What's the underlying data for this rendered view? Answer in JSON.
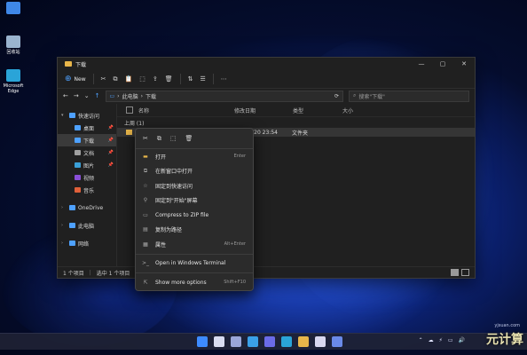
{
  "desktop": {
    "icons": [
      {
        "label": "",
        "icon": "monitor-icon",
        "color": "#3f87e8"
      },
      {
        "label": "回收站",
        "icon": "recycle-bin-icon",
        "color": "#9ab4cf"
      },
      {
        "label": "Microsoft Edge",
        "icon": "edge-icon",
        "color": "#2aa4d8"
      }
    ]
  },
  "window": {
    "title": "下载",
    "controls": [
      "—",
      "▢",
      "✕"
    ]
  },
  "toolbar": {
    "new_label": "New",
    "icons": [
      "cut-icon",
      "copy-icon",
      "paste-icon",
      "rename-icon",
      "share-icon",
      "delete-icon",
      "sort-icon",
      "view-icon",
      "more-icon"
    ],
    "glyphs": {
      "cut": "✂",
      "copy": "⧉",
      "paste": "📋",
      "rename": "⬚",
      "share": "⇪",
      "delete": "🗑",
      "sort": "⇅",
      "view": "☰",
      "more": "⋯"
    }
  },
  "address": {
    "path": [
      "此电脑",
      "下载"
    ],
    "search_placeholder": "搜索\"下载\""
  },
  "nav": {
    "items": [
      {
        "label": "快速访问",
        "icon": "star-icon",
        "color": "#4ea1ff",
        "chev": "▾",
        "level": 0,
        "pin": false,
        "selected": false
      },
      {
        "label": "桌面",
        "icon": "desktop-icon",
        "color": "#4ea1ff",
        "chev": "",
        "level": 1,
        "pin": true,
        "selected": false
      },
      {
        "label": "下载",
        "icon": "download-icon",
        "color": "#4ea1ff",
        "chev": "",
        "level": 1,
        "pin": true,
        "selected": true
      },
      {
        "label": "文档",
        "icon": "document-icon",
        "color": "#a0a0a0",
        "chev": "",
        "level": 1,
        "pin": true,
        "selected": false
      },
      {
        "label": "图片",
        "icon": "picture-icon",
        "color": "#3aa0d8",
        "chev": "",
        "level": 1,
        "pin": true,
        "selected": false
      },
      {
        "label": "视频",
        "icon": "video-icon",
        "color": "#8a4fd8",
        "chev": "",
        "level": 1,
        "pin": false,
        "selected": false
      },
      {
        "label": "音乐",
        "icon": "music-icon",
        "color": "#e0603a",
        "chev": "",
        "level": 1,
        "pin": false,
        "selected": false
      },
      {
        "label": "OneDrive",
        "icon": "cloud-icon",
        "color": "#4ea1ff",
        "chev": "›",
        "level": 0,
        "pin": false,
        "selected": false,
        "gap": true
      },
      {
        "label": "此电脑",
        "icon": "computer-icon",
        "color": "#4ea1ff",
        "chev": "›",
        "level": 0,
        "pin": false,
        "selected": false,
        "gap": true
      },
      {
        "label": "网络",
        "icon": "network-icon",
        "color": "#4ea1ff",
        "chev": "›",
        "level": 0,
        "pin": false,
        "selected": false,
        "gap": true
      }
    ]
  },
  "columns": [
    "名称",
    "修改日期",
    "类型",
    "大小"
  ],
  "group_label": "上周 (1)",
  "files": [
    {
      "name": "",
      "modified": "2021/6/20 23:54",
      "type": "文件夹",
      "size": ""
    }
  ],
  "status": {
    "count": "1 个项目",
    "selected": "选中 1 个项目"
  },
  "context_menu": {
    "top_icons": [
      "✂",
      "⧉",
      "⬚",
      "🗑"
    ],
    "items": [
      {
        "label": "打开",
        "icon": "folder-open-icon",
        "glyph": "▬",
        "color": "#e8b64a",
        "key": "Enter"
      },
      {
        "label": "在新窗口中打开",
        "icon": "new-window-icon",
        "glyph": "⧉",
        "key": ""
      },
      {
        "label": "固定到快速访问",
        "icon": "star-icon",
        "glyph": "☆",
        "key": ""
      },
      {
        "label": "固定到\"开始\"屏幕",
        "icon": "pin-icon",
        "glyph": "⚲",
        "key": ""
      },
      {
        "label": "Compress to ZIP file",
        "icon": "zip-icon",
        "glyph": "▭",
        "key": ""
      },
      {
        "label": "复制为路径",
        "icon": "copy-path-icon",
        "glyph": "▤",
        "key": ""
      },
      {
        "label": "属性",
        "icon": "properties-icon",
        "glyph": "▦",
        "key": "Alt+Enter"
      },
      {
        "sep": true
      },
      {
        "label": "Open in Windows Terminal",
        "icon": "terminal-icon",
        "glyph": ">_",
        "key": ""
      },
      {
        "sep": true
      },
      {
        "label": "Show more options",
        "icon": "more-options-icon",
        "glyph": "⇱",
        "key": "Shift+F10"
      }
    ]
  },
  "taskbar": {
    "apps": [
      {
        "icon": "start-icon",
        "color": "#3d8bff"
      },
      {
        "icon": "search-icon",
        "color": "#d8dcf0"
      },
      {
        "icon": "task-view-icon",
        "color": "#9aa6d8"
      },
      {
        "icon": "widgets-icon",
        "color": "#3aa0e8"
      },
      {
        "icon": "chat-icon",
        "color": "#6b6be8"
      },
      {
        "icon": "edge-icon",
        "color": "#2aa4d8"
      },
      {
        "icon": "explorer-icon",
        "color": "#e8b64a"
      },
      {
        "icon": "store-icon",
        "color": "#d8d8f0"
      },
      {
        "icon": "mail-icon",
        "color": "#6a8ae8"
      }
    ],
    "tray": [
      "⌃",
      "☁",
      "⚡",
      "▭",
      "🔊"
    ]
  },
  "watermark": {
    "text": "元计算",
    "url": "yjsuan.com"
  }
}
